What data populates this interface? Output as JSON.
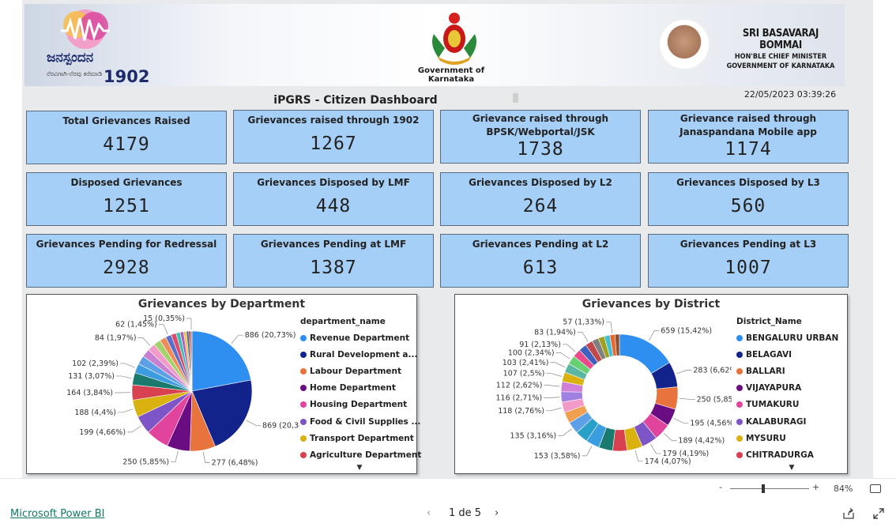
{
  "header": {
    "logo_kannada": "ಜನಸ್ಪಂದನ",
    "logo_tagline": "ನೆರವಿಗಾಗಿ-ನೆರವು ಕರೆಮಾಡಿ",
    "logo_number": "1902",
    "gov_label": "Government of Karnataka",
    "cm_name": "SRI BASAVARAJ BOMMAI",
    "cm_title": "HON'BLE CHIEF MINISTER",
    "cm_gov": "GOVERNMENT OF KARNATAKA"
  },
  "dashboard": {
    "title": "iPGRS - Citizen Dashboard",
    "timestamp": "22/05/2023 03:39:26"
  },
  "cards": [
    {
      "label": "Total Grievances Raised",
      "value": "4179"
    },
    {
      "label": "Grievances raised through 1902",
      "value": "1267"
    },
    {
      "label": "Grievance raised through BPSK/Webportal/JSK",
      "value": "1738"
    },
    {
      "label": "Grievance raised through Janaspandana Mobile app",
      "value": "1174"
    },
    {
      "label": "Disposed Grievances",
      "value": "1251"
    },
    {
      "label": "Grievances Disposed by LMF",
      "value": "448"
    },
    {
      "label": "Grievances Disposed by L2",
      "value": "264"
    },
    {
      "label": "Grievances Disposed by L3",
      "value": "560"
    },
    {
      "label": "Grievances Pending for Redressal",
      "value": "2928"
    },
    {
      "label": "Grievances Pending at LMF",
      "value": "1387"
    },
    {
      "label": "Grievances Pending at L2",
      "value": "613"
    },
    {
      "label": "Grievances Pending at L3",
      "value": "1007"
    }
  ],
  "chart_data": [
    {
      "type": "pie",
      "title": "Grievances by Department",
      "legend_title": "department_name",
      "legend_position": "right",
      "legend": [
        {
          "label": "Revenue Department",
          "color": "#2e8ff0"
        },
        {
          "label": "Rural Development a...",
          "color": "#12238c"
        },
        {
          "label": "Labour Department",
          "color": "#e8733c"
        },
        {
          "label": "Home Department",
          "color": "#6b0d82"
        },
        {
          "label": "Housing Department",
          "color": "#e0449c"
        },
        {
          "label": "Food & Civil Supplies ...",
          "color": "#7d55c7"
        },
        {
          "label": "Transport Department",
          "color": "#d9b20f"
        },
        {
          "label": "Agriculture Department",
          "color": "#d8414f"
        }
      ],
      "slices": [
        {
          "value": 886,
          "label": "886 (20,73%)",
          "color": "#2e8ff0"
        },
        {
          "value": 869,
          "label": "869 (20,34%)",
          "color": "#12238c"
        },
        {
          "value": 277,
          "label": "277 (6,48%)",
          "color": "#e8733c"
        },
        {
          "value": 250,
          "label": "250 (5,85%)",
          "color": "#6b0d82"
        },
        {
          "value": 250,
          "label": "",
          "color": "#e0449c"
        },
        {
          "value": 199,
          "label": "199 (4,66%)",
          "color": "#7d55c7"
        },
        {
          "value": 188,
          "label": "188 (4,4%)",
          "color": "#d9b20f"
        },
        {
          "value": 164,
          "label": "164 (3,84%)",
          "color": "#d8414f"
        },
        {
          "value": 131,
          "label": "131 (3,07%)",
          "color": "#1a7a6e"
        },
        {
          "value": 102,
          "label": "102 (2,39%)",
          "color": "#3b9de0"
        },
        {
          "value": 95,
          "label": "",
          "color": "#5ea0e8"
        },
        {
          "value": 90,
          "label": "",
          "color": "#c880d0"
        },
        {
          "value": 84,
          "label": "84 (1,97%)",
          "color": "#f29ac8"
        },
        {
          "value": 75,
          "label": "",
          "color": "#a3d16a"
        },
        {
          "value": 70,
          "label": "",
          "color": "#f08c5a"
        },
        {
          "value": 62,
          "label": "62 (1,45%)",
          "color": "#5a6fc8"
        },
        {
          "value": 55,
          "label": "",
          "color": "#e04a6a"
        },
        {
          "value": 45,
          "label": "",
          "color": "#3cc0b0"
        },
        {
          "value": 38,
          "label": "",
          "color": "#b060c0"
        },
        {
          "value": 30,
          "label": "",
          "color": "#f0c040"
        },
        {
          "value": 25,
          "label": "",
          "color": "#406090"
        },
        {
          "value": 20,
          "label": "",
          "color": "#c03030"
        },
        {
          "value": 15,
          "label": "15 (0,35%)",
          "color": "#808080"
        }
      ]
    },
    {
      "type": "donut",
      "title": "Grievances by District",
      "legend_title": "District_Name",
      "legend_position": "right",
      "legend": [
        {
          "label": "BENGALURU URBAN",
          "color": "#2e8ff0"
        },
        {
          "label": "BELAGAVI",
          "color": "#12238c"
        },
        {
          "label": "BALLARI",
          "color": "#e8733c"
        },
        {
          "label": "VIJAYAPURA",
          "color": "#6b0d82"
        },
        {
          "label": "TUMAKURU",
          "color": "#e0449c"
        },
        {
          "label": "KALABURAGI",
          "color": "#7d55c7"
        },
        {
          "label": "MYSURU",
          "color": "#d9b20f"
        },
        {
          "label": "CHITRADURGA",
          "color": "#d8414f"
        }
      ],
      "slices": [
        {
          "value": 659,
          "label": "659 (15,42%)",
          "color": "#2e8ff0"
        },
        {
          "value": 283,
          "label": "283 (6,62%)",
          "color": "#12238c"
        },
        {
          "value": 250,
          "label": "250 (5,85%)",
          "color": "#e8733c"
        },
        {
          "value": 195,
          "label": "195 (4,56%)",
          "color": "#6b0d82"
        },
        {
          "value": 189,
          "label": "189 (4,42%)",
          "color": "#e0449c"
        },
        {
          "value": 179,
          "label": "179 (4,19%)",
          "color": "#7d55c7"
        },
        {
          "value": 174,
          "label": "174 (4,07%)",
          "color": "#d9b20f"
        },
        {
          "value": 160,
          "label": "",
          "color": "#d8414f"
        },
        {
          "value": 155,
          "label": "",
          "color": "#1a7a6e"
        },
        {
          "value": 153,
          "label": "153 (3,58%)",
          "color": "#3b9de0"
        },
        {
          "value": 140,
          "label": "",
          "color": "#28a0c8"
        },
        {
          "value": 135,
          "label": "135 (3,16%)",
          "color": "#5ea0e8"
        },
        {
          "value": 125,
          "label": "",
          "color": "#f0a050"
        },
        {
          "value": 118,
          "label": "118 (2,76%)",
          "color": "#f29ac8"
        },
        {
          "value": 116,
          "label": "116 (2,71%)",
          "color": "#a080e0"
        },
        {
          "value": 112,
          "label": "112 (2,62%)",
          "color": "#d080d8"
        },
        {
          "value": 107,
          "label": "107 (2,5%)",
          "color": "#d9b20f"
        },
        {
          "value": 103,
          "label": "103 (2,41%)",
          "color": "#5ab8a0"
        },
        {
          "value": 100,
          "label": "100 (2,34%)",
          "color": "#68d070"
        },
        {
          "value": 91,
          "label": "91 (2,13%)",
          "color": "#e84a8a"
        },
        {
          "value": 88,
          "label": "",
          "color": "#4060c0"
        },
        {
          "value": 83,
          "label": "83 (1,94%)",
          "color": "#c04848"
        },
        {
          "value": 75,
          "label": "",
          "color": "#808080"
        },
        {
          "value": 68,
          "label": "",
          "color": "#a0a020"
        },
        {
          "value": 62,
          "label": "",
          "color": "#40c0d0"
        },
        {
          "value": 57,
          "label": "57 (1,33%)",
          "color": "#e86a30"
        },
        {
          "value": 50,
          "label": "",
          "color": "#905030"
        }
      ]
    }
  ],
  "footer": {
    "zoom_minus": "-",
    "zoom_plus": "+",
    "zoom_level": "84%",
    "pbi_link": "Microsoft Power BI",
    "page_label": "1 de 5",
    "prev": "‹",
    "next": "›"
  }
}
